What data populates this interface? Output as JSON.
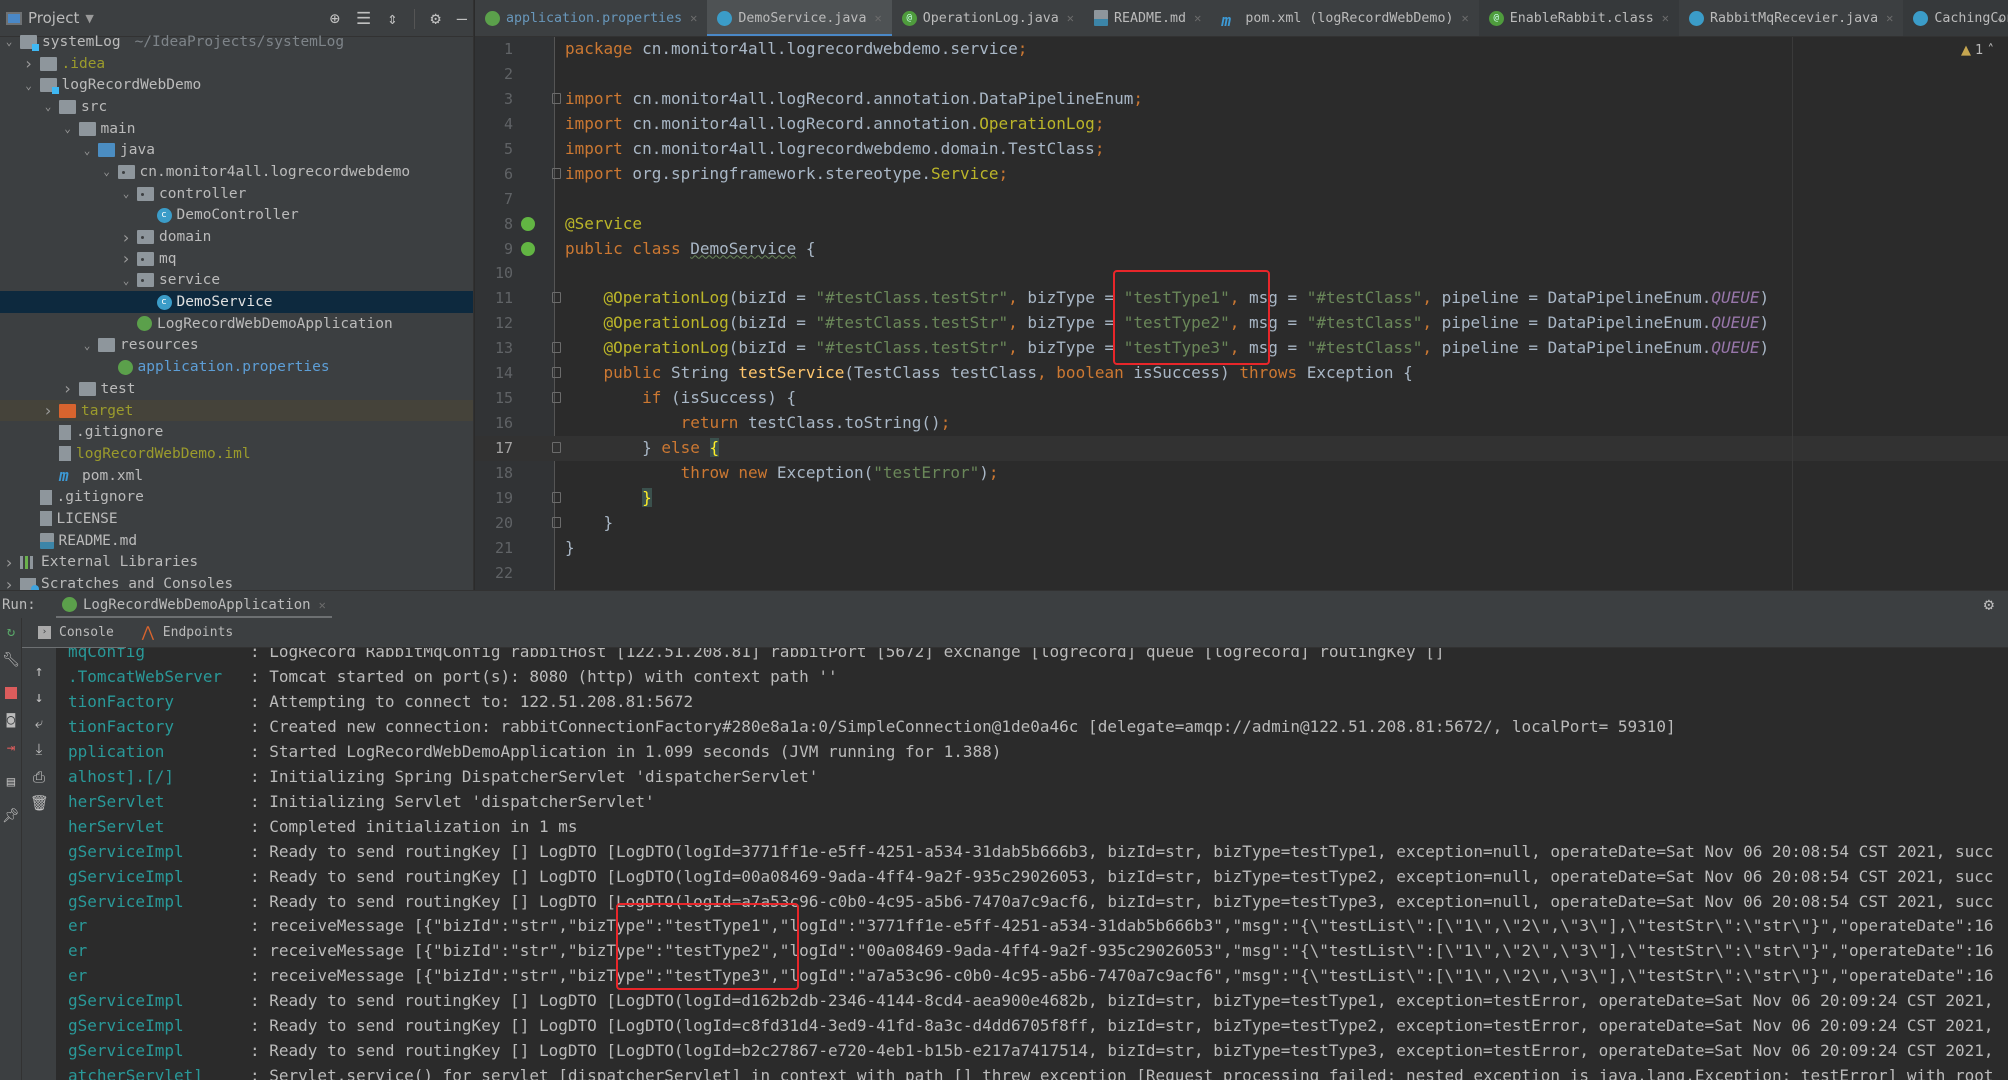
{
  "project_panel": {
    "title": "Project",
    "tools": [
      "locate-icon",
      "expand-all-icon",
      "collapse-all-icon",
      "gear-icon",
      "hide-icon"
    ],
    "tree": [
      {
        "depth": 0,
        "arrow": "open",
        "icon": "module",
        "label": "systemLog",
        "suffix": "~/IdeaProjects/systemLog",
        "style": "default"
      },
      {
        "depth": 1,
        "arrow": "closed",
        "icon": "folder",
        "label": ".idea",
        "style": "olive"
      },
      {
        "depth": 1,
        "arrow": "open",
        "icon": "module",
        "label": "logRecordWebDemo",
        "style": "default"
      },
      {
        "depth": 2,
        "arrow": "open",
        "icon": "folder",
        "label": "src",
        "style": "default"
      },
      {
        "depth": 3,
        "arrow": "open",
        "icon": "folder",
        "label": "main",
        "style": "default"
      },
      {
        "depth": 4,
        "arrow": "open",
        "icon": "folder-src",
        "label": "java",
        "style": "default"
      },
      {
        "depth": 5,
        "arrow": "open",
        "icon": "package",
        "label": "cn.monitor4all.logrecordwebdemo",
        "style": "default"
      },
      {
        "depth": 6,
        "arrow": "open",
        "icon": "package",
        "label": "controller",
        "style": "default"
      },
      {
        "depth": 7,
        "arrow": "none",
        "icon": "class",
        "label": "DemoController",
        "style": "default"
      },
      {
        "depth": 6,
        "arrow": "closed",
        "icon": "package",
        "label": "domain",
        "style": "default"
      },
      {
        "depth": 6,
        "arrow": "closed",
        "icon": "package",
        "label": "mq",
        "style": "default"
      },
      {
        "depth": 6,
        "arrow": "open",
        "icon": "package",
        "label": "service",
        "style": "default"
      },
      {
        "depth": 7,
        "arrow": "none",
        "icon": "class",
        "label": "DemoService",
        "style": "selected"
      },
      {
        "depth": 6,
        "arrow": "none",
        "icon": "spring",
        "label": "LogRecordWebDemoApplication",
        "style": "default"
      },
      {
        "depth": 4,
        "arrow": "open",
        "icon": "folder",
        "label": "resources",
        "style": "default"
      },
      {
        "depth": 5,
        "arrow": "none",
        "icon": "spring",
        "label": "application.properties",
        "style": "link"
      },
      {
        "depth": 3,
        "arrow": "closed",
        "icon": "folder",
        "label": "test",
        "style": "default"
      },
      {
        "depth": 2,
        "arrow": "closed",
        "icon": "folder-target",
        "label": "target",
        "style": "excluded"
      },
      {
        "depth": 2,
        "arrow": "none",
        "icon": "file",
        "label": ".gitignore",
        "style": "default"
      },
      {
        "depth": 2,
        "arrow": "none",
        "icon": "file",
        "label": "logRecordWebDemo.iml",
        "style": "olive"
      },
      {
        "depth": 2,
        "arrow": "none",
        "icon": "maven",
        "label": "pom.xml",
        "style": "default"
      },
      {
        "depth": 1,
        "arrow": "none",
        "icon": "file",
        "label": ".gitignore",
        "style": "default"
      },
      {
        "depth": 1,
        "arrow": "none",
        "icon": "file",
        "label": "LICENSE",
        "style": "default"
      },
      {
        "depth": 1,
        "arrow": "none",
        "icon": "md",
        "label": "README.md",
        "style": "default"
      },
      {
        "depth": 0,
        "arrow": "closed",
        "icon": "libs",
        "label": "External Libraries",
        "style": "default"
      },
      {
        "depth": 0,
        "arrow": "closed",
        "icon": "scratch",
        "label": "Scratches and Consoles",
        "style": "default"
      }
    ]
  },
  "editor_tabs": [
    {
      "label": "application.properties",
      "icon": "spring",
      "active": false,
      "style": "prop"
    },
    {
      "label": "DemoService.java",
      "icon": "class",
      "active": true
    },
    {
      "label": "OperationLog.java",
      "icon": "annotation",
      "active": false
    },
    {
      "label": "README.md",
      "icon": "md",
      "active": false
    },
    {
      "label": "pom.xml (logRecordWebDemo)",
      "icon": "maven",
      "active": false
    },
    {
      "label": "EnableRabbit.class",
      "icon": "annotation",
      "active": false,
      "dark": true
    },
    {
      "label": "RabbitMqRecevier.java",
      "icon": "class",
      "active": false
    },
    {
      "label": "CachingConnectionFac",
      "icon": "class",
      "active": false,
      "dark": true
    }
  ],
  "editor": {
    "warnings": "1",
    "current_line": 17,
    "lines": [
      {
        "n": 1,
        "html": "<span class='kw'>package</span> cn.monitor4all.logrecordwebdemo.service<span class='kw'>;</span>"
      },
      {
        "n": 2,
        "html": ""
      },
      {
        "n": 3,
        "fold": true,
        "html": "<span class='kw'>import</span> cn.monitor4all.logRecord.annotation.DataPipelineEnum<span class='kw'>;</span>"
      },
      {
        "n": 4,
        "html": "<span class='kw'>import</span> cn.monitor4all.logRecord.annotation.<span class='anno'>OperationLog</span><span class='kw'>;</span>"
      },
      {
        "n": 5,
        "html": "<span class='kw'>import</span> cn.monitor4all.logrecordwebdemo.domain.TestClass<span class='kw'>;</span>"
      },
      {
        "n": 6,
        "fold": true,
        "html": "<span class='kw'>import</span> org.springframework.stereotype.<span class='anno'>Service</span><span class='kw'>;</span>"
      },
      {
        "n": 7,
        "html": ""
      },
      {
        "n": 8,
        "gicon": "bean",
        "html": "<span class='anno'>@Service</span>"
      },
      {
        "n": 9,
        "gicon": "bean",
        "html": "<span class='kw'>public class</span> <span class='underline-wavy'>DemoService</span> {"
      },
      {
        "n": 10,
        "html": ""
      },
      {
        "n": 11,
        "fold": true,
        "html": "    <span class='anno'>@OperationLog</span>(bizId = <span class='str'>\"#testClass.testStr\"</span><span class='kw'>,</span> bizType = <span class='str'>\"testType1\"</span><span class='kw'>,</span> msg = <span class='str'>\"#testClass\"</span><span class='kw'>,</span> pipeline = DataPipelineEnum.<span class='enum'>QUEUE</span>)"
      },
      {
        "n": 12,
        "html": "    <span class='anno'>@OperationLog</span>(bizId = <span class='str'>\"#testClass.testStr\"</span><span class='kw'>,</span> bizType = <span class='str'>\"testType2\"</span><span class='kw'>,</span> msg = <span class='str'>\"#testClass\"</span><span class='kw'>,</span> pipeline = DataPipelineEnum.<span class='enum'>QUEUE</span>)"
      },
      {
        "n": 13,
        "fold": true,
        "html": "    <span class='anno'>@OperationLog</span>(bizId = <span class='str'>\"#testClass.testStr\"</span><span class='kw'>,</span> bizType = <span class='str'>\"testType3\"</span><span class='kw'>,</span> msg = <span class='str'>\"#testClass\"</span><span class='kw'>,</span> pipeline = DataPipelineEnum.<span class='enum'>QUEUE</span>)"
      },
      {
        "n": 14,
        "fold": true,
        "html": "    <span class='kw'>public</span> String <span class='fn'>testService</span>(TestClass testClass<span class='kw'>,</span> <span class='kw'>boolean</span> isSuccess) <span class='kw'>throws</span> Exception {"
      },
      {
        "n": 15,
        "fold": true,
        "html": "        <span class='kw'>if</span> (isSuccess) {"
      },
      {
        "n": 16,
        "html": "            <span class='kw'>return</span> testClass.toString()<span class='kw'>;</span>"
      },
      {
        "n": 17,
        "fold": true,
        "html": "        } <span class='kw'>else</span> <span class='brace-hl'>{</span>"
      },
      {
        "n": 18,
        "html": "            <span class='kw'>throw new</span> Exception(<span class='str'>\"testError\"</span>)<span class='kw'>;</span>"
      },
      {
        "n": 19,
        "fold": true,
        "html": "        <span class='brace-hl'>}</span>"
      },
      {
        "n": 20,
        "fold": true,
        "html": "    }"
      },
      {
        "n": 21,
        "html": "}"
      },
      {
        "n": 22,
        "html": ""
      }
    ]
  },
  "run_panel": {
    "label": "Run:",
    "config": "LogRecordWebDemoApplication",
    "tabs": [
      "Console",
      "Endpoints"
    ],
    "side_buttons": [
      "rerun-icon",
      "wrench-icon",
      "stop-icon",
      "camera-icon",
      "exit-icon",
      "layout-icon",
      "pin-icon"
    ],
    "console_tools": [
      "up-arrow-icon",
      "down-arrow-icon",
      "soft-wrap-icon",
      "scroll-to-end-icon",
      "print-icon",
      "trash-icon"
    ],
    "log_lines": [
      {
        "src": "mqConfig",
        "msg": ": LogRecord RabbitMqConfig rabbitHost [122.51.208.81] rabbitPort [5672] exchange [logrecord] queue [logrecord] routingKey []"
      },
      {
        "src": ".TomcatWebServer",
        "msg": ": Tomcat started on port(s): 8080 (http) with context path ''"
      },
      {
        "src": "tionFactory",
        "msg": ": Attempting to connect to: 122.51.208.81:5672"
      },
      {
        "src": "tionFactory",
        "msg": ": Created new connection: rabbitConnectionFactory#280e8a1a:0/SimpleConnection@1de0a46c [delegate=amqp://admin@122.51.208.81:5672/, localPort= 59310]"
      },
      {
        "src": "pplication",
        "msg": ": Started LogRecordWebDemoApplication in 1.099 seconds (JVM running for 1.388)"
      },
      {
        "src": "alhost].[/]",
        "msg": ": Initializing Spring DispatcherServlet 'dispatcherServlet'"
      },
      {
        "src": "herServlet",
        "msg": ": Initializing Servlet 'dispatcherServlet'"
      },
      {
        "src": "herServlet",
        "msg": ": Completed initialization in 1 ms"
      },
      {
        "src": "gServiceImpl",
        "msg": ": Ready to send routingKey [] LogDTO [LogDTO(logId=3771ff1e-e5ff-4251-a534-31dab5b666b3, bizId=str, bizType=testType1, exception=null, operateDate=Sat Nov 06 20:08:54 CST 2021, succ"
      },
      {
        "src": "gServiceImpl",
        "msg": ": Ready to send routingKey [] LogDTO [LogDTO(logId=00a08469-9ada-4ff4-9a2f-935c29026053, bizId=str, bizType=testType2, exception=null, operateDate=Sat Nov 06 20:08:54 CST 2021, succ"
      },
      {
        "src": "gServiceImpl",
        "msg": ": Ready to send routingKey [] LogDTO [LogDTO(logId=a7a53c96-c0b0-4c95-a5b6-7470a7c9acf6, bizId=str, bizType=testType3, exception=null, operateDate=Sat Nov 06 20:08:54 CST 2021, succ"
      },
      {
        "src": "er",
        "msg": ": receiveMessage [{\"bizId\":\"str\",\"bizType\":\"testType1\",\"logId\":\"3771ff1e-e5ff-4251-a534-31dab5b666b3\",\"msg\":\"{\\\"testList\\\":[\\\"1\\\",\\\"2\\\",\\\"3\\\"],\\\"testStr\\\":\\\"str\\\"}\",\"operateDate\":16"
      },
      {
        "src": "er",
        "msg": ": receiveMessage [{\"bizId\":\"str\",\"bizType\":\"testType2\",\"logId\":\"00a08469-9ada-4ff4-9a2f-935c29026053\",\"msg\":\"{\\\"testList\\\":[\\\"1\\\",\\\"2\\\",\\\"3\\\"],\\\"testStr\\\":\\\"str\\\"}\",\"operateDate\":16"
      },
      {
        "src": "er",
        "msg": ": receiveMessage [{\"bizId\":\"str\",\"bizType\":\"testType3\",\"logId\":\"a7a53c96-c0b0-4c95-a5b6-7470a7c9acf6\",\"msg\":\"{\\\"testList\\\":[\\\"1\\\",\\\"2\\\",\\\"3\\\"],\\\"testStr\\\":\\\"str\\\"}\",\"operateDate\":16"
      },
      {
        "src": "gServiceImpl",
        "msg": ": Ready to send routingKey [] LogDTO [LogDTO(logId=d162b2db-2346-4144-8cd4-aea900e4682b, bizId=str, bizType=testType1, exception=testError, operateDate=Sat Nov 06 20:09:24 CST 2021,"
      },
      {
        "src": "gServiceImpl",
        "msg": ": Ready to send routingKey [] LogDTO [LogDTO(logId=c8fd31d4-3ed9-41fd-8a3c-d4dd6705f8ff, bizId=str, bizType=testType2, exception=testError, operateDate=Sat Nov 06 20:09:24 CST 2021,"
      },
      {
        "src": "gServiceImpl",
        "msg": ": Ready to send routingKey [] LogDTO [LogDTO(logId=b2c27867-e720-4eb1-b15b-e217a7417514, bizId=str, bizType=testType3, exception=testError, operateDate=Sat Nov 06 20:09:24 CST 2021,"
      },
      {
        "src": "atcherServlet]",
        "msg": ": Servlet.service() for servlet [dispatcherServlet] in context with path [] threw exception [Request processing failed; nested exception is java.lang.Exception: testError] with root"
      }
    ]
  },
  "highlight_color": "#e8262a"
}
